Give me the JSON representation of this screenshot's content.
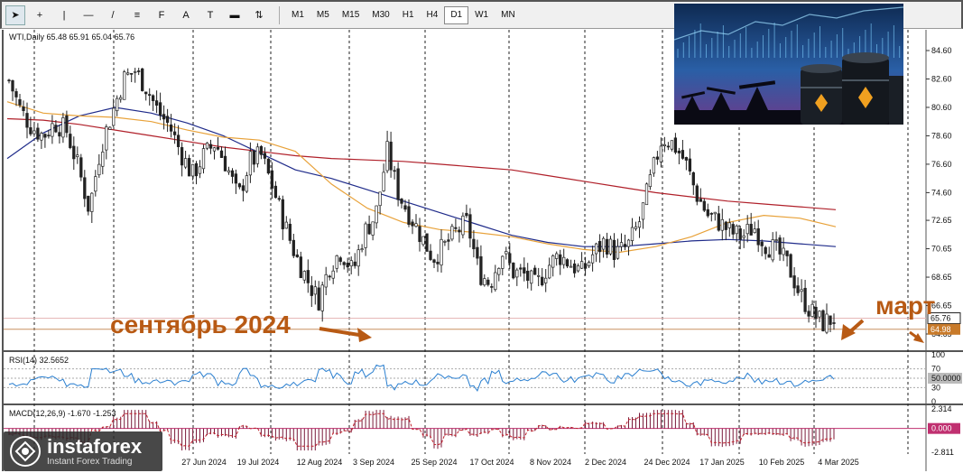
{
  "toolbar": {
    "tools": [
      {
        "name": "cursor-icon",
        "glyph": "➤"
      },
      {
        "name": "crosshair-icon",
        "glyph": "+"
      },
      {
        "name": "vertical-line-icon",
        "glyph": "|"
      },
      {
        "name": "horizontal-line-icon",
        "glyph": "—"
      },
      {
        "name": "trend-line-icon",
        "glyph": "/"
      },
      {
        "name": "fibonacci-icon",
        "glyph": "≡"
      },
      {
        "name": "fibonacci-fan-icon",
        "glyph": "F"
      },
      {
        "name": "text-icon",
        "glyph": "A"
      },
      {
        "name": "text-label-icon",
        "glyph": "T"
      },
      {
        "name": "rectangle-icon",
        "glyph": "▬"
      },
      {
        "name": "arrows-icon",
        "glyph": "⇅"
      }
    ],
    "timeframes": [
      "M1",
      "M5",
      "M15",
      "M30",
      "H1",
      "H4",
      "D1",
      "W1",
      "MN"
    ],
    "active_timeframe": "D1"
  },
  "chart": {
    "header": "WTI,Daily  65.48 65.91 65.04 65.76",
    "price_labels": [
      "84.60",
      "82.60",
      "80.60",
      "78.60",
      "76.60",
      "74.60",
      "72.65",
      "70.65",
      "68.65",
      "66.65",
      "64.65"
    ],
    "current_price": "65.76",
    "support_price": "64.98",
    "date_labels": [
      "27 Jun 2024",
      "19 Jul 2024",
      "12 Aug 2024",
      "3 Sep 2024",
      "25 Sep 2024",
      "17 Oct 2024",
      "8 Nov 2024",
      "2 Dec 2024",
      "24 Dec 2024",
      "17 Jan 2025",
      "10 Feb 2025",
      "4 Mar 2025"
    ],
    "annotation_left": "сентябрь 2024",
    "annotation_right": "март",
    "annotation_color": "#b85a14",
    "candle_up_color": "#222222",
    "candle_down_color": "#222222",
    "ma_fast_color": "#e8a23a",
    "ma_mid_color": "#1f2b8a",
    "ma_slow_color": "#b0202a"
  },
  "rsi": {
    "label": "RSI(14) 32.5652",
    "levels": [
      "100",
      "70",
      "50.0000",
      "30",
      "0"
    ],
    "line_color": "#2a7fd0"
  },
  "macd": {
    "label": "MACD(12,26,9) -1.670 -1.253",
    "levels": [
      "2.314",
      "0.000",
      "-2.811"
    ],
    "hist_color": "#7a1a3a",
    "signal_color": "#c0202a"
  },
  "logo": {
    "name": "instaforex",
    "tagline": "Instant Forex Trading"
  },
  "chart_data": {
    "type": "candlestick",
    "title": "WTI,Daily",
    "x_labels": [
      "27 Jun 2024",
      "19 Jul 2024",
      "12 Aug 2024",
      "3 Sep 2024",
      "25 Sep 2024",
      "17 Oct 2024",
      "8 Nov 2024",
      "2 Dec 2024",
      "24 Dec 2024",
      "17 Jan 2025",
      "10 Feb 2025",
      "4 Mar 2025"
    ],
    "ylim": [
      64.65,
      84.6
    ],
    "close_path": [
      82.5,
      80.4,
      79.2,
      78.6,
      79.5,
      79.0,
      76.5,
      73.4,
      77.8,
      80.2,
      82.6,
      83.2,
      82.0,
      80.3,
      79.3,
      77.4,
      75.8,
      77.2,
      78.1,
      76.5,
      74.2,
      76.8,
      77.2,
      75.0,
      72.5,
      70.2,
      68.5,
      67.0,
      69.5,
      70.5,
      69.0,
      71.8,
      73.0,
      77.5,
      74.5,
      73.0,
      71.5,
      70.0,
      70.8,
      71.8,
      72.5,
      69.0,
      68.2,
      70.5,
      69.0,
      68.8,
      68.0,
      69.4,
      70.2,
      69.6,
      69.0,
      70.3,
      71.2,
      70.3,
      70.8,
      72.5,
      75.5,
      78.5,
      78.0,
      76.8,
      74.5,
      73.0,
      72.5,
      71.8,
      71.5,
      72.2,
      71.0,
      70.5,
      69.5,
      67.5,
      66.2,
      65.4,
      65.76
    ],
    "moving_averages": [
      {
        "values": [
          81.0,
          80.2,
          80.0,
          79.9,
          79.6,
          79.0,
          78.5,
          78.3,
          77.5,
          75.2,
          73.5,
          72.5,
          72.0,
          71.8,
          71.5,
          71.0,
          70.6,
          70.4,
          70.8,
          71.5,
          72.5,
          73.0,
          72.8,
          72.2
        ]
      },
      {
        "values": [
          77.0,
          78.8,
          80.0,
          80.6,
          80.2,
          79.5,
          78.6,
          77.4,
          76.2,
          75.6,
          74.8,
          74.0,
          73.2,
          72.4,
          71.6,
          71.1,
          70.8,
          70.8,
          71.0,
          71.2,
          71.3,
          71.2,
          71.0,
          70.8
        ]
      },
      {
        "values": [
          79.8,
          79.7,
          79.4,
          79.0,
          78.6,
          78.2,
          77.8,
          77.5,
          77.2,
          77.0,
          76.9,
          76.8,
          76.6,
          76.4,
          76.2,
          75.8,
          75.4,
          75.0,
          74.6,
          74.3,
          74.0,
          73.8,
          73.6,
          73.4
        ]
      }
    ],
    "rsi_last": 32.5652,
    "macd_last": -1.67,
    "macd_signal_last": -1.253
  }
}
